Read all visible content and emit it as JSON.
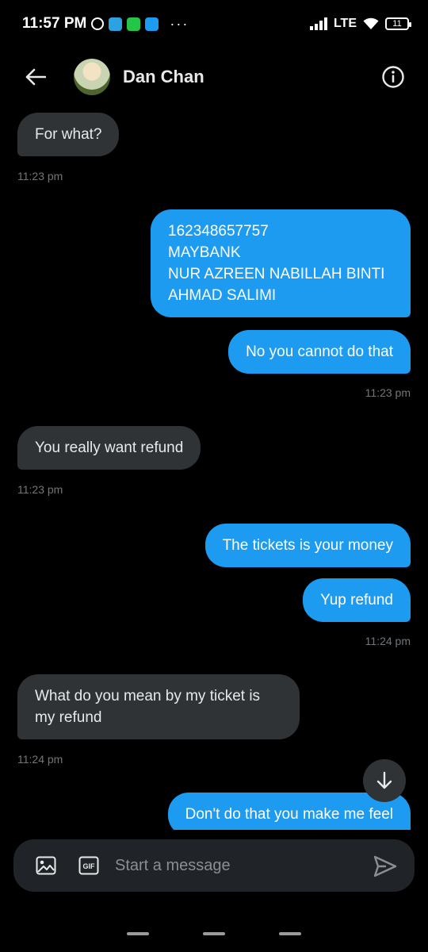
{
  "status_bar": {
    "time": "11:57 PM",
    "network": "LTE",
    "battery": "11",
    "more": "···"
  },
  "header": {
    "contact_name": "Dan Chan"
  },
  "messages": [
    {
      "side": "in",
      "text": "For what?",
      "time": "11:23 pm"
    },
    {
      "side": "out",
      "lines": [
        "162348657757",
        "MAYBANK",
        "NUR AZREEN NABILLAH BINTI",
        "AHMAD SALIMI"
      ]
    },
    {
      "side": "out",
      "text": "No you cannot do that",
      "time": "11:23 pm"
    },
    {
      "side": "in",
      "text": "You really want refund",
      "time": "11:23 pm"
    },
    {
      "side": "out",
      "text": "The tickets is your money"
    },
    {
      "side": "out",
      "text": "Yup refund",
      "time": "11:24 pm"
    },
    {
      "side": "in",
      "lines": [
        "What do you mean by my ticket is",
        "my refund"
      ],
      "time": "11:24 pm"
    },
    {
      "side": "out",
      "text": "Don't do that you make me feel"
    }
  ],
  "composer": {
    "placeholder": "Start a message"
  },
  "colors": {
    "outgoing_bubble": "#1d9bf0",
    "incoming_bubble": "#2f3336",
    "background": "#000000"
  }
}
